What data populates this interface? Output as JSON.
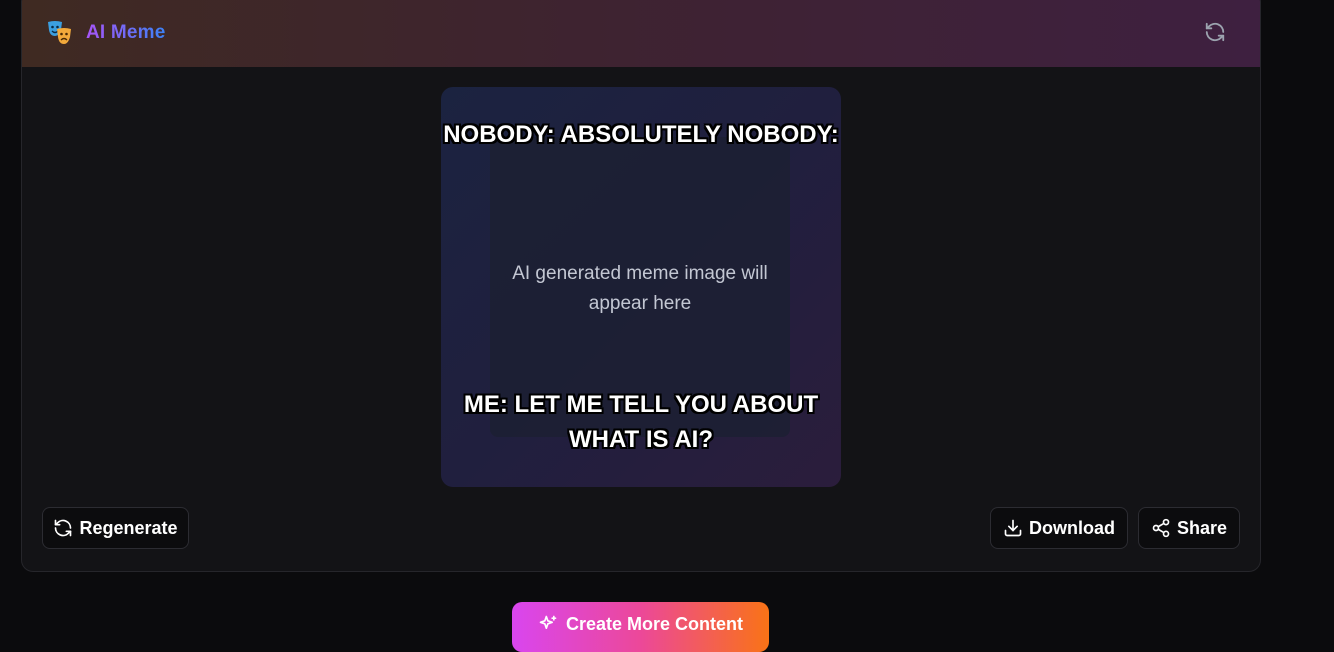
{
  "header": {
    "title": "AI Meme",
    "logo_icon": "theater-masks-icon",
    "refresh_icon": "refresh-icon"
  },
  "meme": {
    "top_text": "NOBODY: ABSOLUTELY NOBODY:",
    "bottom_text": "ME: LET ME TELL YOU ABOUT WHAT IS AI?",
    "placeholder": "AI generated meme image will appear here"
  },
  "actions": {
    "regenerate_label": "Regenerate",
    "regenerate_icon": "refresh-icon",
    "download_label": "Download",
    "download_icon": "download-icon",
    "share_label": "Share",
    "share_icon": "share-icon"
  },
  "cta": {
    "label": "Create More Content",
    "icon": "sparkles-icon"
  },
  "colors": {
    "brand_gradient_start": "#a855f7",
    "brand_gradient_end": "#3b82f6",
    "cta_gradient_start": "#d946ef",
    "cta_gradient_end": "#f97316",
    "background": "#0b0b0d"
  }
}
